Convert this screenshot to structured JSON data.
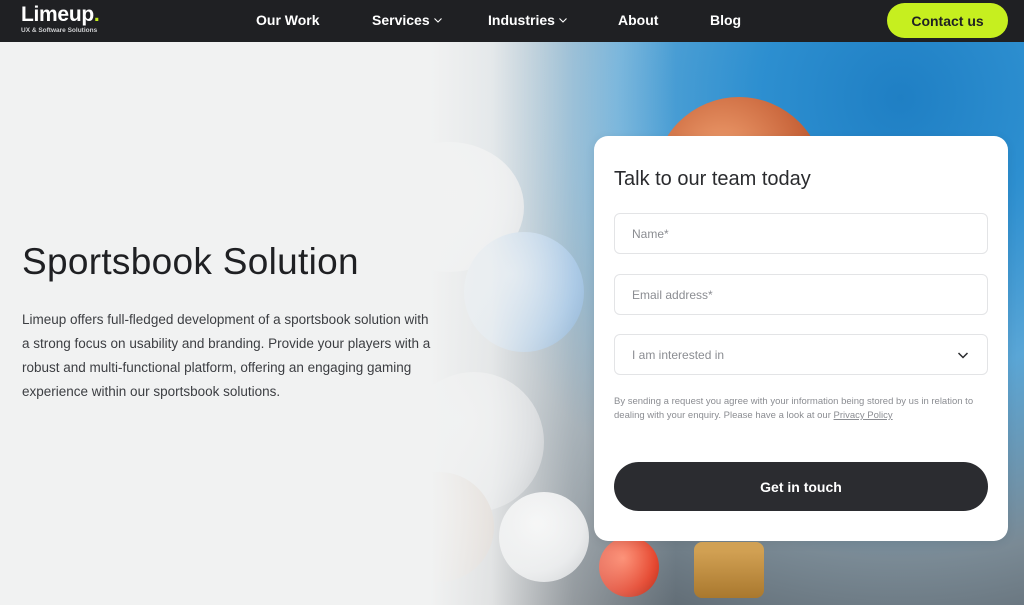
{
  "brand": {
    "name": "Limeup",
    "dot": ".",
    "tagline": "UX & Software Solutions",
    "accent_color": "#c6ef1f"
  },
  "nav": {
    "items": [
      {
        "label": "Our Work",
        "has_dropdown": false
      },
      {
        "label": "Services",
        "has_dropdown": true
      },
      {
        "label": "Industries",
        "has_dropdown": true
      },
      {
        "label": "About",
        "has_dropdown": false
      },
      {
        "label": "Blog",
        "has_dropdown": false
      }
    ],
    "contact_label": "Contact us"
  },
  "hero": {
    "title": "Sportsbook Solution",
    "description": "Limeup offers full-fledged development of a sportsbook solution with a strong focus on usability and branding. Provide your players with a robust and multi-functional platform, offering an engaging gaming experience within our sportsbook solutions."
  },
  "form": {
    "title": "Talk to our team today",
    "name_placeholder": "Name*",
    "email_placeholder": "Email address*",
    "interest_label": "I am interested in",
    "consent_text": "By sending a request you agree with your information being stored by us in relation to dealing with your enquiry. Please have a look at our ",
    "privacy_link": "Privacy Policy",
    "submit_label": "Get in touch"
  },
  "icons": {
    "nav_dropdown": "chevron-down-icon",
    "select_dropdown": "chevron-down-icon"
  }
}
